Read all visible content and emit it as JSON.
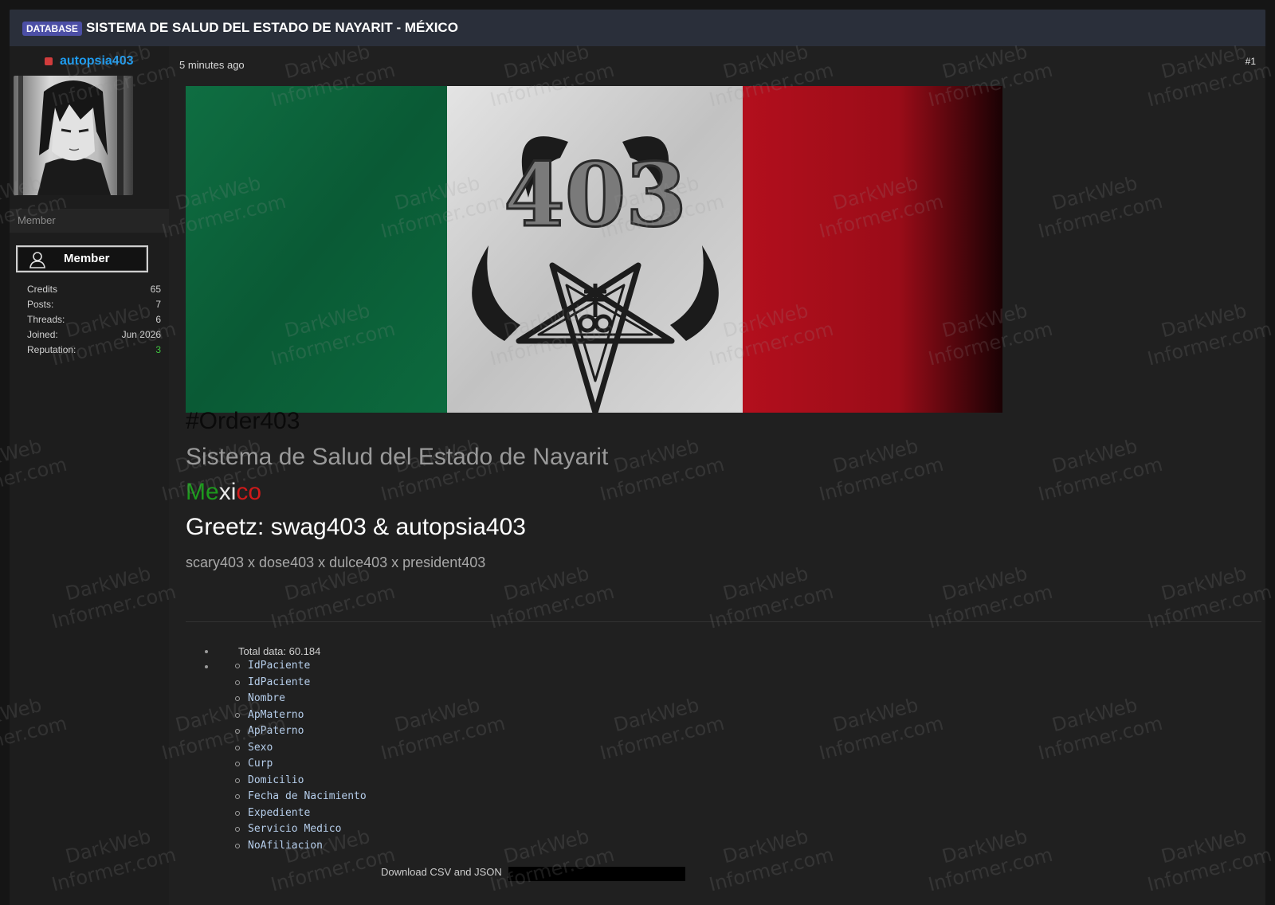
{
  "thread": {
    "prefix": "DATABASE",
    "title": "SISTEMA DE SALUD DEL ESTADO DE NAYARIT - MÉXICO"
  },
  "author": {
    "username": "autopsia403",
    "usertitle": "Member",
    "rank_label": "Member",
    "stats": [
      {
        "label": "Credits",
        "value": "65"
      },
      {
        "label": "Posts:",
        "value": "7"
      },
      {
        "label": "Threads:",
        "value": "6"
      },
      {
        "label": "Joined:",
        "value": "Jun 2026"
      },
      {
        "label": "Reputation:",
        "value": "3"
      }
    ],
    "reputation_color": "#3fc33f"
  },
  "post": {
    "time": "5 minutes ago",
    "number": "#1",
    "banner_text": "403",
    "order": "#Order403",
    "subtitle": "Sistema de Salud del Estado de Nayarit",
    "country": {
      "part1": "Me",
      "part2": "xi",
      "part3": "co"
    },
    "greetz": "Greetz: swag403 & autopsia403",
    "crew": "scary403 x dose403 x dulce403 x president403",
    "total_data": "Total data: 60.184",
    "fields": [
      "IdPaciente",
      "IdPaciente",
      "Nombre",
      "ApMaterno",
      "ApPaterno",
      "Sexo",
      "Curp",
      "Domicilio",
      "Fecha de Nacimiento",
      "Expediente",
      "Servicio Medico",
      "NoAfiliacion"
    ],
    "download_label": "Download CSV and JSON"
  },
  "watermark": {
    "line1": "DarkWeb",
    "line2": "Informer.com"
  },
  "colors": {
    "flag_green": "#0d6b3c",
    "flag_white": "#d6d6d6",
    "flag_red": "#b0101e",
    "username": "#1e9cf0",
    "prefix_badge": "#4c4fa6"
  }
}
